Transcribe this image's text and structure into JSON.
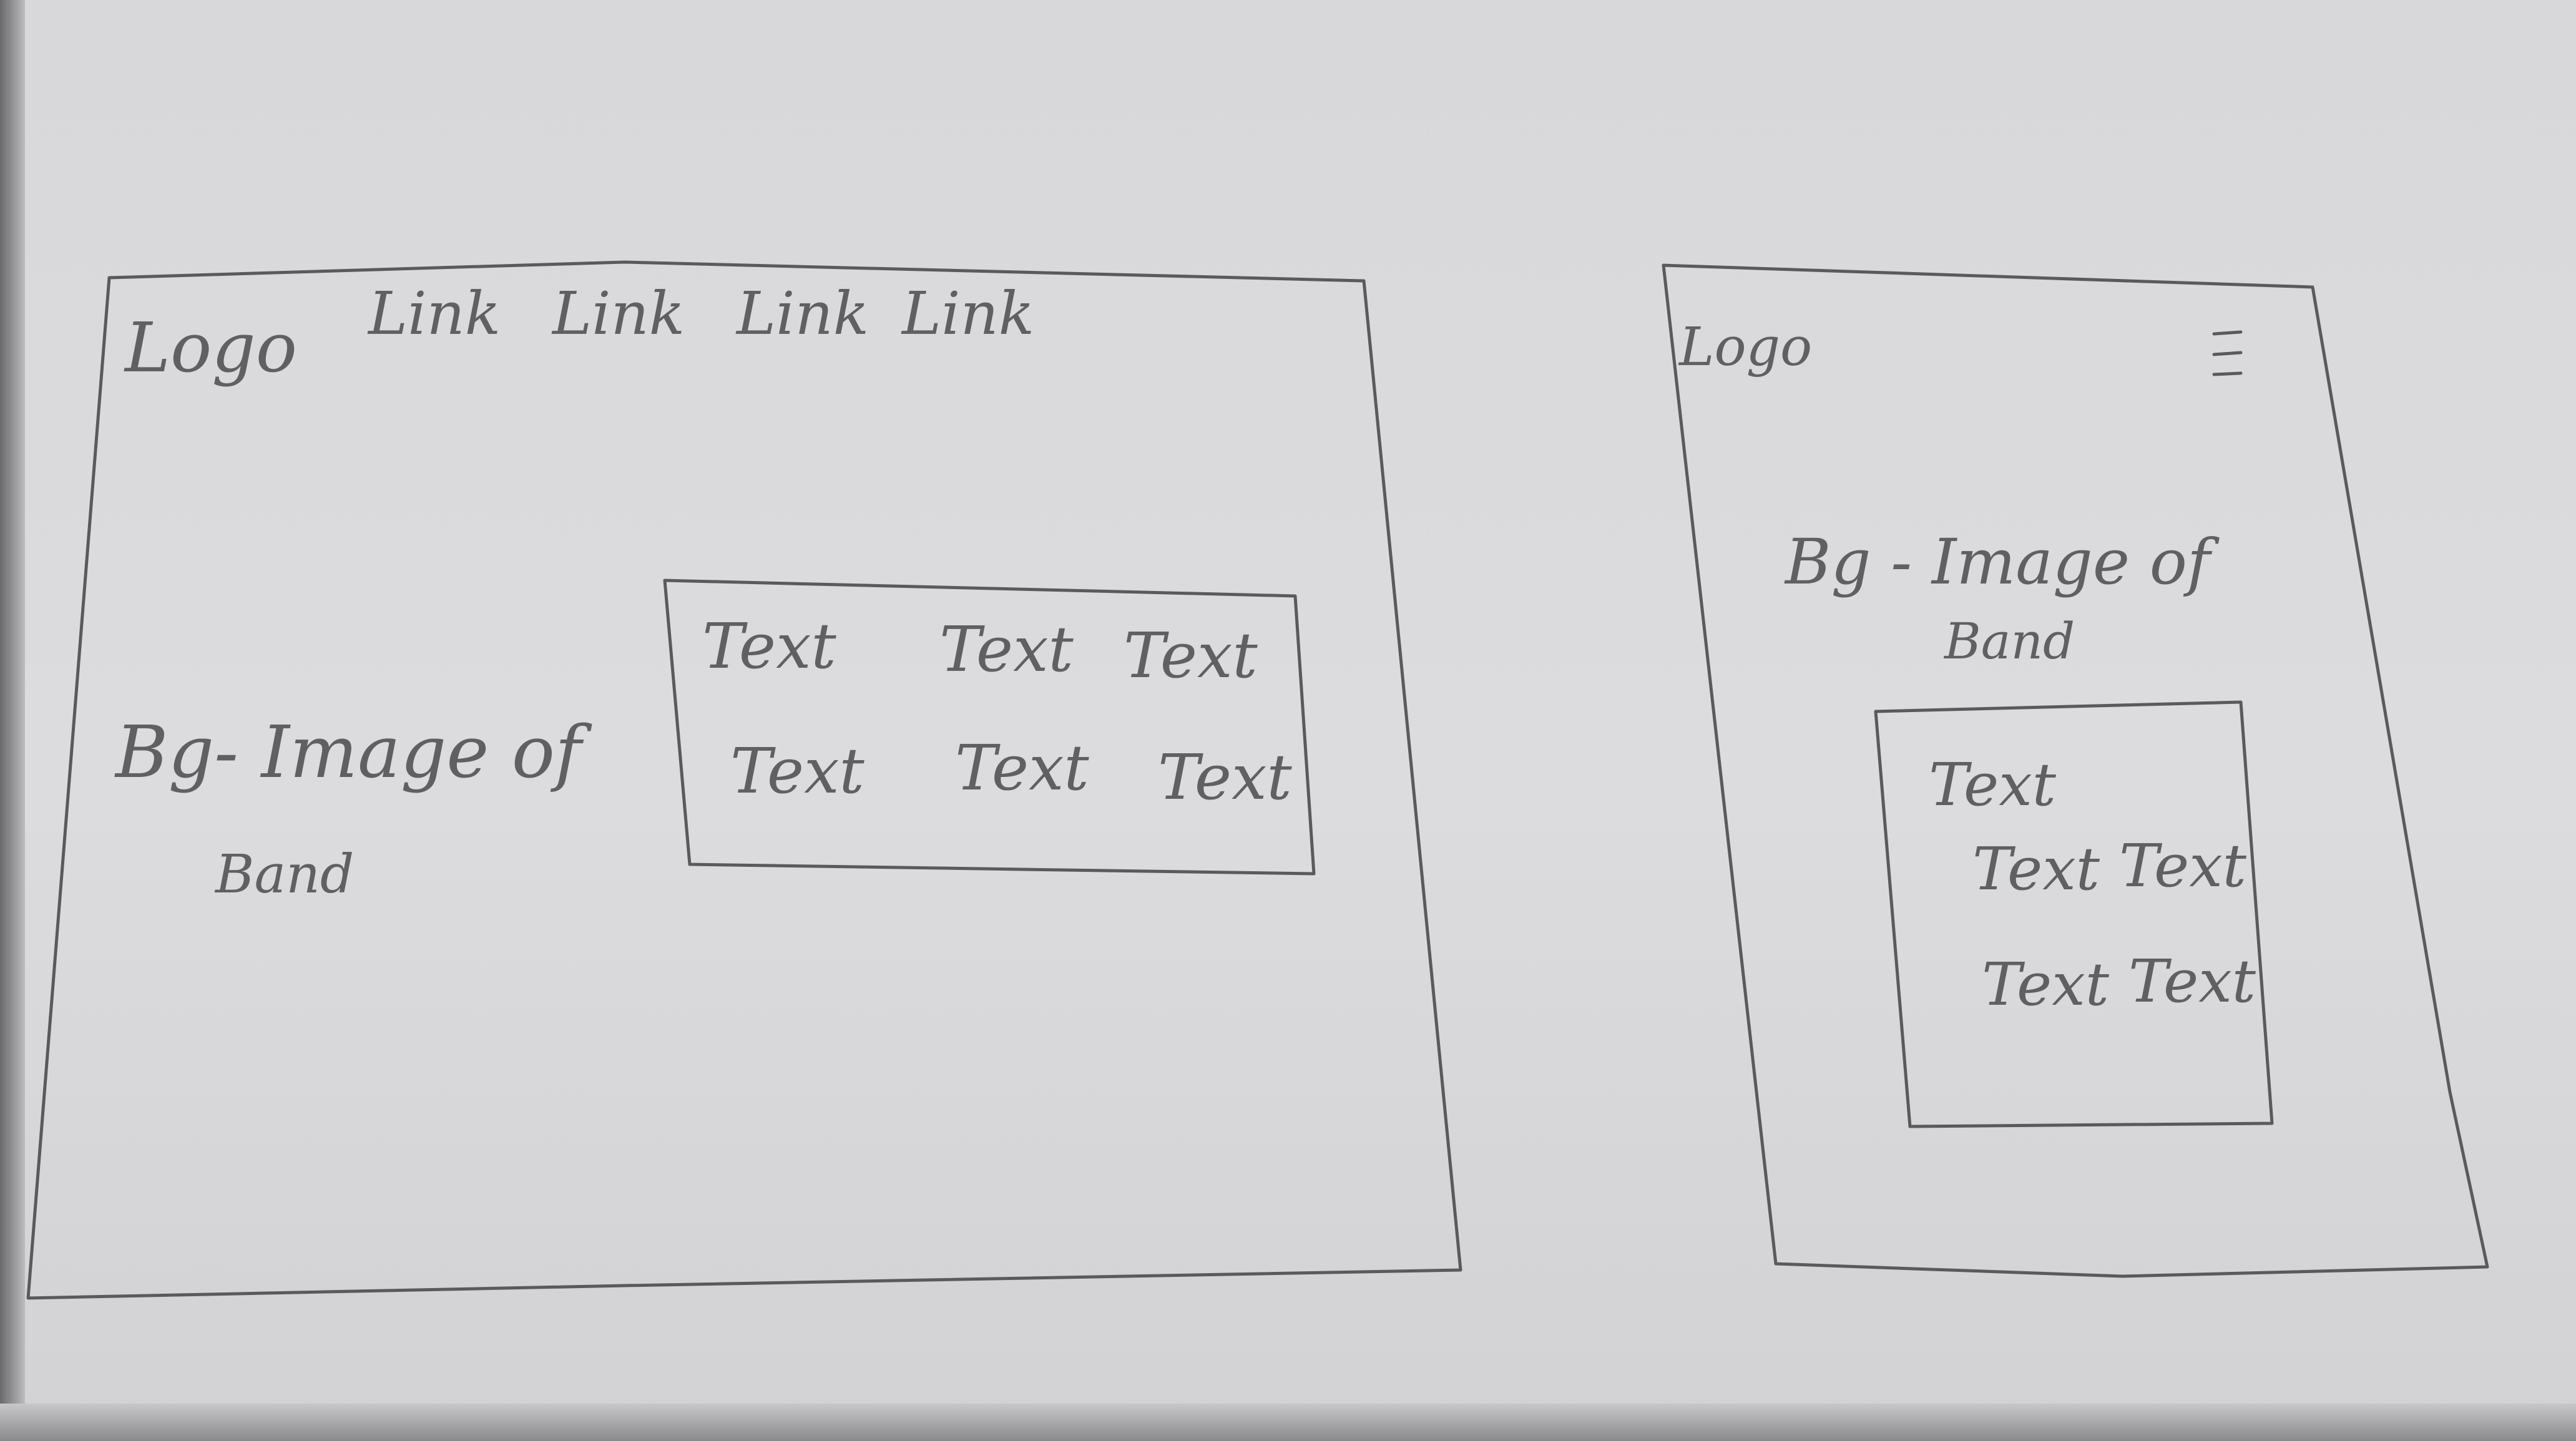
{
  "desktop": {
    "logo": "Logo",
    "nav_links": [
      "Link",
      "Link",
      "Link",
      "Link"
    ],
    "bg_label_line1": "Bg- Image of",
    "bg_label_line2": "Band",
    "card_row1": [
      "Text",
      "Text",
      "Text"
    ],
    "card_row2": [
      "Text",
      "Text",
      "Text"
    ]
  },
  "mobile": {
    "logo": "Logo",
    "menu_icon": "hamburger-icon",
    "bg_label_line1": "Bg - Image of",
    "bg_label_line2": "Band",
    "card_line1": "Text",
    "card_row2": [
      "Text",
      "Text"
    ],
    "card_row3": [
      "Text",
      "Text"
    ]
  },
  "colors": {
    "paper": "#dcdcde",
    "pencil": "#5a5a5c"
  }
}
